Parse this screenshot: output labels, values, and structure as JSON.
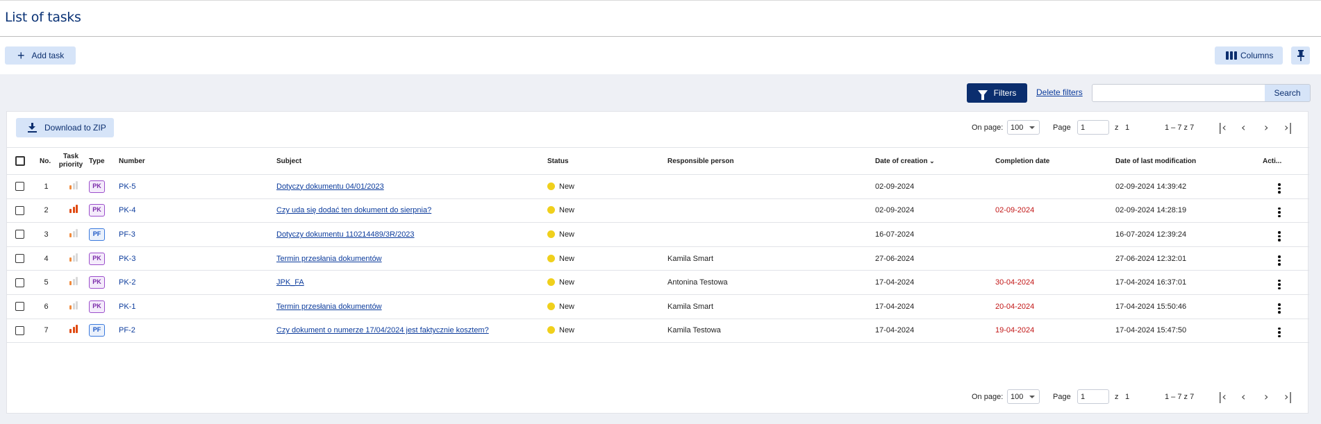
{
  "page_title": "List of tasks",
  "toolbar": {
    "add_task": "Add task",
    "columns": "Columns"
  },
  "filters": {
    "filters_label": "Filters",
    "delete_filters": "Delete filters",
    "search_value": "",
    "search_label": "Search"
  },
  "download_label": "Download to ZIP",
  "pager": {
    "on_page_label": "On page:",
    "per_page": "100",
    "page_label": "Page",
    "page_value": "1",
    "of_label": "z",
    "total_pages": "1",
    "range": "1 – 7 z 7"
  },
  "columns": {
    "no": "No.",
    "priority_line1": "Task",
    "priority_line2": "priority",
    "type": "Type",
    "number": "Number",
    "subject": "Subject",
    "status": "Status",
    "responsible": "Responsible person",
    "created": "Date of creation",
    "completion": "Completion date",
    "modified": "Date of last modification",
    "actions": "Acti..."
  },
  "colors": {
    "priority_high": "#e04a12",
    "priority_mid": "#f08a3c",
    "priority_off": "#d9d9d9",
    "status_new": "#f0d01c",
    "overdue": "#c21616"
  },
  "rows": [
    {
      "no": "1",
      "priority": 1,
      "type": "PK",
      "number": "PK-5",
      "subject": "Dotyczy dokumentu 04/01/2023",
      "status": "New",
      "responsible": "",
      "created": "02-09-2024",
      "completion": "",
      "modified": "02-09-2024 14:39:42"
    },
    {
      "no": "2",
      "priority": 3,
      "type": "PK",
      "number": "PK-4",
      "subject": "Czy uda się dodać ten dokument do sierpnia?",
      "status": "New",
      "responsible": "",
      "created": "02-09-2024",
      "completion": "02-09-2024",
      "modified": "02-09-2024 14:28:19"
    },
    {
      "no": "3",
      "priority": 1,
      "type": "PF",
      "number": "PF-3",
      "subject": "Dotyczy dokumentu 110214489/3R/2023",
      "status": "New",
      "responsible": "",
      "created": "16-07-2024",
      "completion": "",
      "modified": "16-07-2024 12:39:24"
    },
    {
      "no": "4",
      "priority": 1,
      "type": "PK",
      "number": "PK-3",
      "subject": "Termin przesłania dokumentów",
      "status": "New",
      "responsible": "Kamila Smart",
      "created": "27-06-2024",
      "completion": "",
      "modified": "27-06-2024 12:32:01"
    },
    {
      "no": "5",
      "priority": 1,
      "type": "PK",
      "number": "PK-2",
      "subject": "JPK_FA",
      "status": "New",
      "responsible": "Antonina Testowa",
      "created": "17-04-2024",
      "completion": "30-04-2024",
      "modified": "17-04-2024 16:37:01"
    },
    {
      "no": "6",
      "priority": 1,
      "type": "PK",
      "number": "PK-1",
      "subject": "Termin przesłania dokumentów",
      "status": "New",
      "responsible": "Kamila Smart",
      "created": "17-04-2024",
      "completion": "20-04-2024",
      "modified": "17-04-2024 15:50:46"
    },
    {
      "no": "7",
      "priority": 3,
      "type": "PF",
      "number": "PF-2",
      "subject": "Czy dokument o numerze 17/04/2024 jest faktycznie kosztem?",
      "status": "New",
      "responsible": "Kamila Testowa",
      "created": "17-04-2024",
      "completion": "19-04-2024",
      "modified": "17-04-2024 15:47:50"
    }
  ]
}
